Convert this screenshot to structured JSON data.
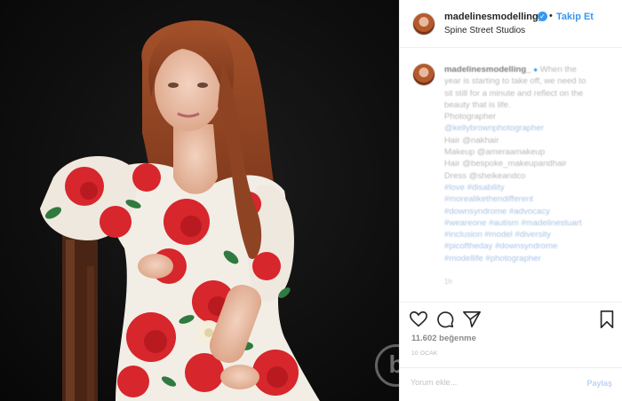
{
  "post": {
    "username": "madelinesmodelling_",
    "follow_label": "Takip Et",
    "location": "Spine Street Studios",
    "caption_user": "madelinesmodelling_",
    "caption_lines": [
      "When the",
      "year is starting to take off, we need to",
      "sit still for a minute and reflect on the",
      "beauty that is life.",
      "Photographer",
      "@kellybrownphotographer",
      "Hair @nakhair",
      "Makeup @ameraamakeup",
      "Hair @bespoke_makeupandhair",
      "Dress @sheikeandco",
      "#love #disability",
      "#morealikethendifferent",
      "#downsyndrome #advocacy",
      "#weareone #autism #madelinestuart",
      "#inclusion #model #diversity",
      "#picoftheday #downsyndrome",
      "#modellife #photographer"
    ],
    "time_ago": "1h",
    "likes": "11.602 beğenme",
    "date": "10 OCAK",
    "comment_placeholder": "Yorum ekle...",
    "post_label": "Paylaş"
  },
  "icons": {
    "verified": "verified-badge-icon",
    "like": "heart-icon",
    "comment": "comment-icon",
    "share": "share-icon",
    "save": "bookmark-icon",
    "watermark": "watermark-logo"
  },
  "colors": {
    "accent": "#3897f0",
    "border": "#efefef",
    "text": "#262626"
  }
}
